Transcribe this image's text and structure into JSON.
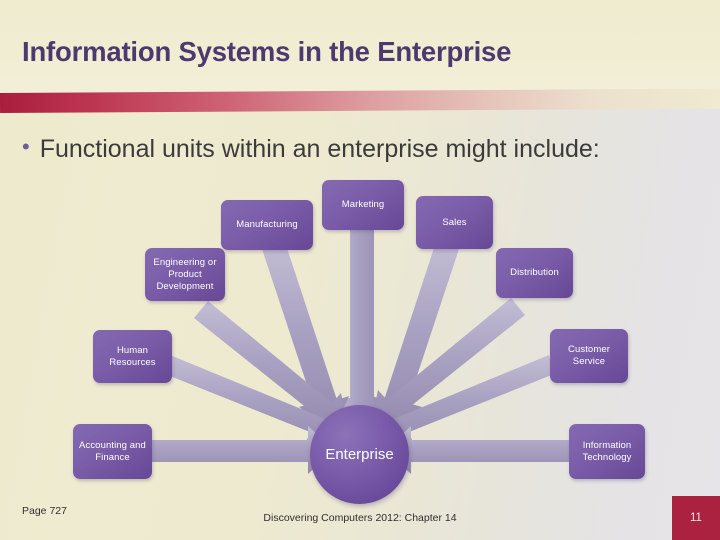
{
  "slide": {
    "title": "Information Systems in the Enterprise",
    "bullet_marker": "•",
    "bullet_text": "Functional units within an enterprise might include:",
    "title_color": "#4c3a6e",
    "band_color": "#a81e3c",
    "node_color": "#7a5caa",
    "center_color": "#6b4c9c",
    "connector_color": "#a9a2c0"
  },
  "diagram": {
    "center_label": "Enterprise",
    "nodes": [
      {
        "id": "marketing",
        "label": "Marketing"
      },
      {
        "id": "manufacturing",
        "label": "Manufacturing"
      },
      {
        "id": "sales",
        "label": "Sales"
      },
      {
        "id": "engineering",
        "label": "Engineering or Product Development"
      },
      {
        "id": "distribution",
        "label": "Distribution"
      },
      {
        "id": "hr",
        "label": "Human Resources"
      },
      {
        "id": "cs",
        "label": "Customer Service"
      },
      {
        "id": "accounting",
        "label": "Accounting and Finance"
      },
      {
        "id": "it",
        "label": "Information Technology"
      }
    ]
  },
  "footer": {
    "page_reference": "Page 727",
    "source": "Discovering Computers 2012: Chapter 14",
    "slide_number": "11"
  }
}
